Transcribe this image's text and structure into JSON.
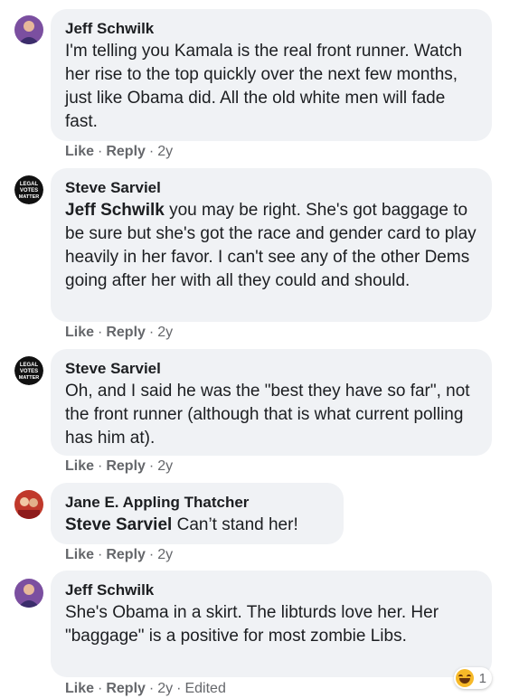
{
  "comments": [
    {
      "author": "Jeff Schwilk",
      "text": "I'm telling you Kamala is the real front runner. Watch her rise to the top quickly over the next few months, just like Obama did. All the old white men will fade fast.",
      "like": "Like",
      "reply": "Reply",
      "time": "2y"
    },
    {
      "author": "Steve Sarviel",
      "mention": "Jeff Schwilk",
      "text": " you may be right. She's got baggage to be sure but she's got the race and gender card to play heavily in her favor. I can't see any of the other Dems going after her with all they could and should.",
      "like": "Like",
      "reply": "Reply",
      "time": "2y",
      "avatar_text": "LEGAL VOTES MATTER"
    },
    {
      "author": "Steve Sarviel",
      "text": "Oh, and I said he was the \"best they have so far\", not the front runner (although that is what current polling has him at).",
      "like": "Like",
      "reply": "Reply",
      "time": "2y",
      "avatar_text": "LEGAL VOTES MATTER"
    },
    {
      "author": "Jane E. Appling Thatcher",
      "mention": "Steve Sarviel",
      "text": " Can’t stand her!",
      "like": "Like",
      "reply": "Reply",
      "time": "2y"
    },
    {
      "author": "Jeff Schwilk",
      "text": "She's Obama in a skirt. The libturds love her. Her \"baggage\" is a positive for most zombie Libs.",
      "like": "Like",
      "reply": "Reply",
      "time": "2y",
      "edited": "Edited",
      "reaction": {
        "icon": "laughing-emoji-icon",
        "count": "1"
      }
    }
  ],
  "colors": {
    "bubble": "#f0f2f5",
    "meta": "#65676b",
    "text": "#1c1e21"
  }
}
